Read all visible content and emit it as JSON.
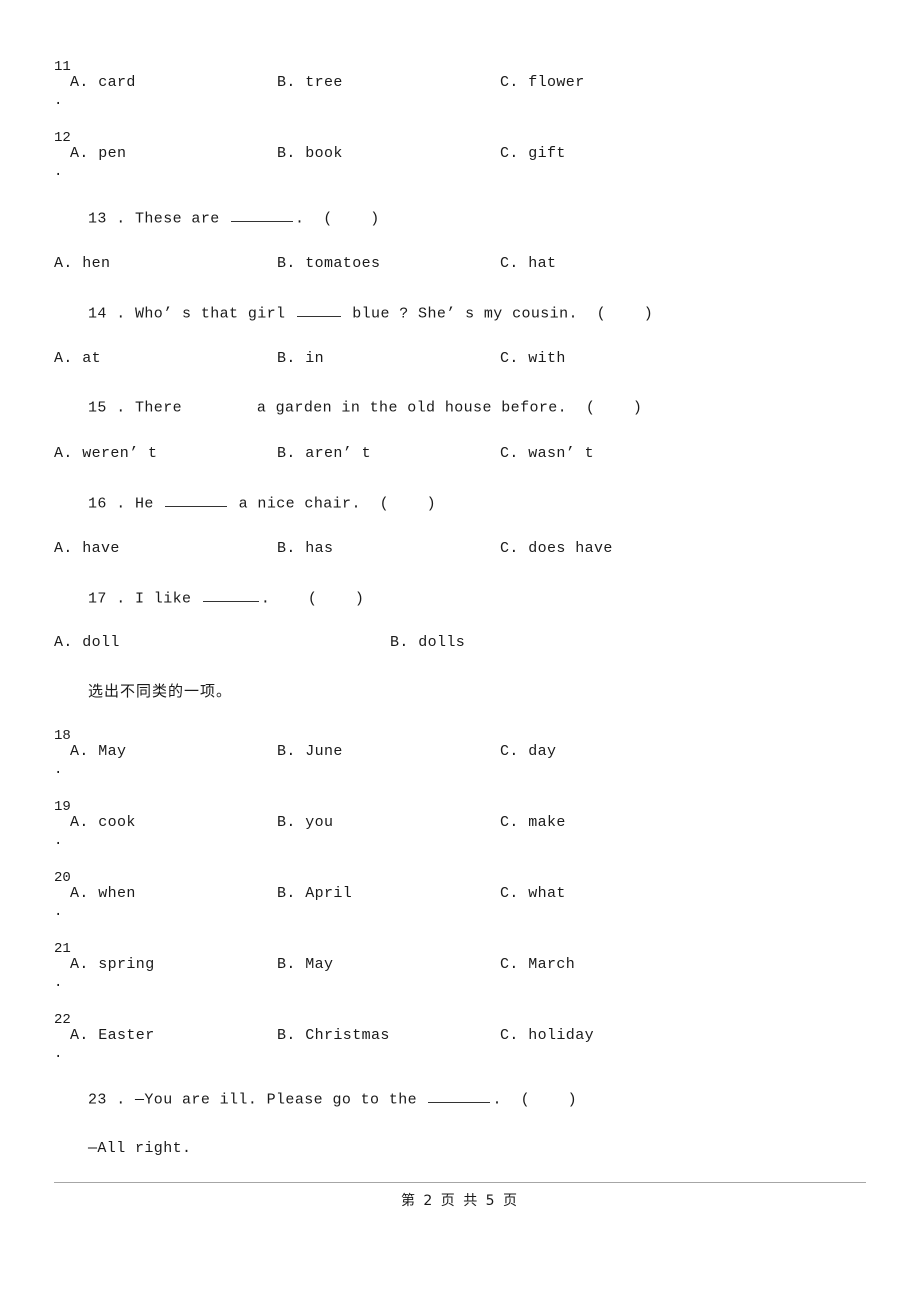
{
  "document": {
    "instruction_cn": "选出不同类的一项。",
    "footer": "第 2 页 共 5 页"
  },
  "items": {
    "q11": {
      "number": "11",
      "dot": ".",
      "a": "A. card",
      "b": "B. tree",
      "c": "C. flower"
    },
    "q12": {
      "number": "12",
      "dot": ".",
      "a": "A. pen",
      "b": "B. book",
      "c": "C. gift"
    },
    "q13": {
      "stem_pre": "13 . These are ",
      "stem_post": ".  (    )",
      "a": "A. hen",
      "b": "B. tomatoes",
      "c": "C. hat"
    },
    "q14": {
      "stem_pre": "14 . Who’ s that girl ",
      "stem_post": " blue ? She’ s my cousin.  (    )",
      "a": "A. at",
      "b": "B. in",
      "c": "C. with"
    },
    "q15": {
      "stem_pre": "15 . There ",
      "stem_post": " a garden in the old house before.  (    )",
      "a": "A. weren’ t",
      "b": "B. aren’ t",
      "c": "C. wasn’ t"
    },
    "q16": {
      "stem_pre": "16 . He ",
      "stem_post": " a nice chair.  (    )",
      "a": "A. have",
      "b": "B. has",
      "c": "C. does have"
    },
    "q17": {
      "stem_pre": "17 . I like ",
      "stem_post": ".    (    )",
      "a": "A. doll",
      "b": "B. dolls"
    },
    "q18": {
      "number": "18",
      "dot": ".",
      "a": "A. May",
      "b": "B. June",
      "c": "C. day"
    },
    "q19": {
      "number": "19",
      "dot": ".",
      "a": "A. cook",
      "b": "B. you",
      "c": "C. make"
    },
    "q20": {
      "number": "20",
      "dot": ".",
      "a": "A. when",
      "b": "B. April",
      "c": "C. what"
    },
    "q21": {
      "number": "21",
      "dot": ".",
      "a": "A. spring",
      "b": "B. May",
      "c": "C. March"
    },
    "q22": {
      "number": "22",
      "dot": ".",
      "a": "A. Easter",
      "b": "B. Christmas",
      "c": "C. holiday"
    },
    "q23": {
      "stem_pre": "23 . —You are ill. Please go to the ",
      "stem_post": ".  (    )",
      "reply": "—All right."
    }
  }
}
